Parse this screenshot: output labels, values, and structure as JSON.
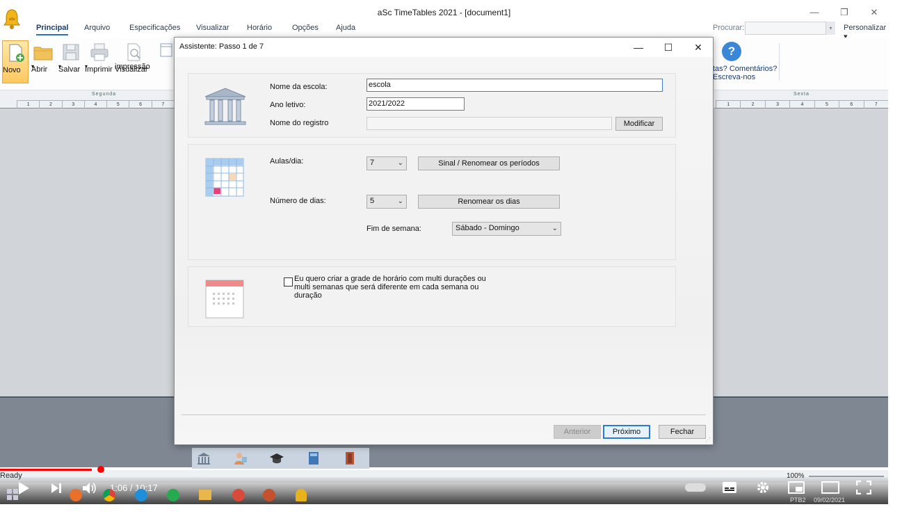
{
  "app": {
    "title": "aSc TimeTables 2021  - [document1]",
    "window_controls": {
      "minimize": "—",
      "restore": "❐",
      "close": "✕"
    }
  },
  "menu": {
    "items": [
      "Principal",
      "Arquivo",
      "Especificações",
      "Visualizar",
      "Horário",
      "Opções",
      "Ajuda"
    ],
    "search_label": "Procurar:",
    "customize": "Personalizar ▾"
  },
  "ribbon": {
    "novo": "Novo",
    "abrir": "Abrir",
    "salvar": "Salvar",
    "imprimir": "Imprimir",
    "visualizar_1": "Visualizar",
    "visualizar_2": "impressão",
    "help_1": "tas? Comentários?",
    "help_2": "Escreva-nos"
  },
  "timeline": {
    "left_day": "Segunda",
    "right_day": "Sexta",
    "periods": [
      "1",
      "2",
      "3",
      "4",
      "5",
      "6",
      "7"
    ]
  },
  "dialog": {
    "title": "Assistente: Passo 1 de 7",
    "controls": {
      "minimize": "—",
      "maximize": "☐",
      "close": "✕"
    },
    "school_name_label": "Nome da escola:",
    "school_name_value": "escola",
    "year_label": "Ano letivo:",
    "year_value": "2021/2022",
    "registry_label": "Nome do registro",
    "registry_value": "",
    "modify_button": "Modificar",
    "lessons_label": "Aulas/dia:",
    "lessons_value": "7",
    "rename_periods_button": "Sinal / Renomear os períodos",
    "days_label": "Número de dias:",
    "days_value": "5",
    "rename_days_button": "Renomear os dias",
    "weekend_label": "Fim de semana:",
    "weekend_value": "Sábado - Domingo",
    "multi_text": "Eu quero criar a grade de horário com multi durações ou multi semanas que será diferente em cada semana ou duração",
    "multi_checked": false,
    "prev_button": "Anterior",
    "next_button": "Próximo",
    "close_button": "Fechar"
  },
  "status": {
    "ready": "Ready",
    "zoom": "100%"
  },
  "video": {
    "time": "1:06 / 10:17",
    "progress_fraction": 0.103
  },
  "taskbar": {
    "lang": "PTB2",
    "date": "09/02/2021"
  }
}
